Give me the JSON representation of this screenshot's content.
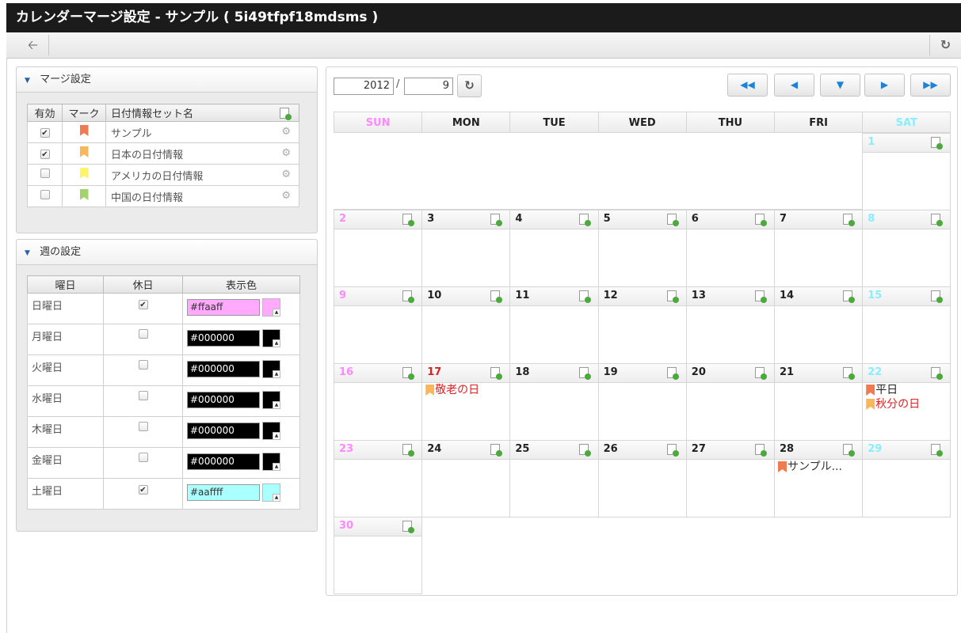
{
  "window": {
    "title": "カレンダーマージ設定 - サンプル ( 5i49tfpf18mdsms )"
  },
  "toolbar": {
    "back_icon": "back-arrow-icon",
    "refresh_icon": "refresh-icon"
  },
  "merge_panel": {
    "title": "マージ設定",
    "headers": {
      "enabled": "有効",
      "mark": "マーク",
      "name": "日付情報セット名"
    },
    "rows": [
      {
        "checked": true,
        "mark_color": "#f07b50",
        "name": "サンプル"
      },
      {
        "checked": true,
        "mark_color": "#f9b75a",
        "name": "日本の日付情報"
      },
      {
        "checked": false,
        "mark_color": "#fff36a",
        "name": "アメリカの日付情報"
      },
      {
        "checked": false,
        "mark_color": "#a4d36c",
        "name": "中国の日付情報"
      }
    ]
  },
  "week_panel": {
    "title": "週の設定",
    "headers": {
      "day": "曜日",
      "holiday": "休日",
      "color": "表示色"
    },
    "rows": [
      {
        "day": "日曜日",
        "holiday": true,
        "color": "#ffaaff"
      },
      {
        "day": "月曜日",
        "holiday": false,
        "color": "#000000"
      },
      {
        "day": "火曜日",
        "holiday": false,
        "color": "#000000"
      },
      {
        "day": "水曜日",
        "holiday": false,
        "color": "#000000"
      },
      {
        "day": "木曜日",
        "holiday": false,
        "color": "#000000"
      },
      {
        "day": "金曜日",
        "holiday": false,
        "color": "#000000"
      },
      {
        "day": "土曜日",
        "holiday": true,
        "color": "#aaffff"
      }
    ]
  },
  "calendar": {
    "year": "2012",
    "separator": "/",
    "month": "9",
    "weekdays": [
      "SUN",
      "MON",
      "TUE",
      "WED",
      "THU",
      "FRI",
      "SAT"
    ],
    "weekday_colors": [
      "#ff88ff",
      "#222222",
      "#222222",
      "#222222",
      "#222222",
      "#222222",
      "#88eeff"
    ],
    "nav_icons": [
      "prev-year-icon",
      "prev-month-icon",
      "today-icon",
      "next-month-icon",
      "next-year-icon"
    ],
    "first_weekday": 6,
    "days_in_month": 30,
    "day_colors": {
      "sunday": "#ff88ff",
      "saturday": "#88eeff",
      "holiday": "#e02020",
      "normal": "#222222"
    },
    "holiday_days": [
      17
    ],
    "events": {
      "17": [
        {
          "label": "敬老の日",
          "mark_color": "#f9b75a",
          "text_color": "#e02020"
        }
      ],
      "22": [
        {
          "label": "平日",
          "mark_color": "#f07b50",
          "text_color": "#222222"
        },
        {
          "label": "秋分の日",
          "mark_color": "#f9b75a",
          "text_color": "#e02020"
        }
      ],
      "28": [
        {
          "label": "サンプル...",
          "mark_color": "#f07b50",
          "text_color": "#333333"
        }
      ]
    }
  }
}
